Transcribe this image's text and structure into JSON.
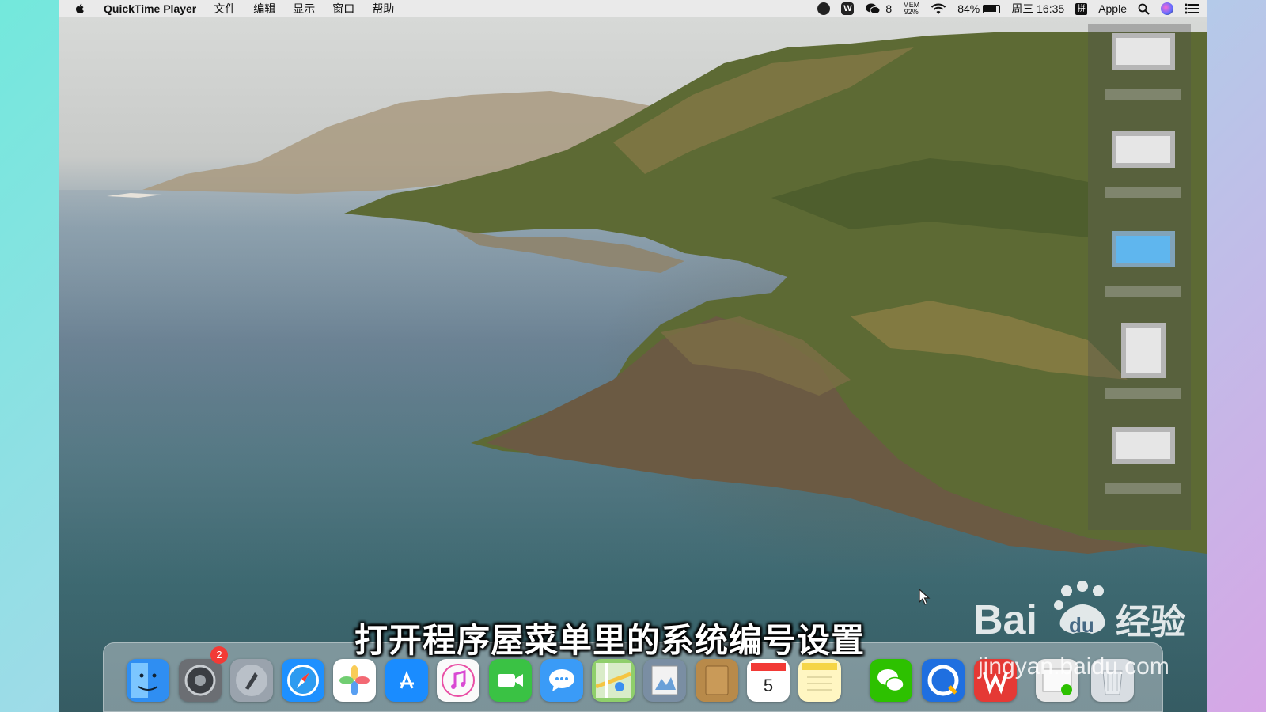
{
  "menubar": {
    "app_name": "QuickTime Player",
    "menus": [
      "文件",
      "编辑",
      "显示",
      "窗口",
      "帮助"
    ],
    "wechat_count": "8",
    "mem_label": "MEM",
    "mem_value": "92%",
    "battery_percent": "84%",
    "battery_level": 0.84,
    "datetime": "周三 16:35",
    "input_method": "拼",
    "user": "Apple"
  },
  "desktop_items": [
    "file",
    "file",
    "folder",
    "document",
    "file"
  ],
  "dock": {
    "icons": [
      {
        "name": "finder-icon",
        "color": "#2f8ef2"
      },
      {
        "name": "system-preferences-icon",
        "color": "#6b6e73",
        "badge": "2"
      },
      {
        "name": "launchpad-icon",
        "color": "#9aa3ad"
      },
      {
        "name": "safari-icon",
        "color": "#1e90ff"
      },
      {
        "name": "photos-icon",
        "color": "#ffffff"
      },
      {
        "name": "app-store-icon",
        "color": "#1a8cff"
      },
      {
        "name": "itunes-icon",
        "color": "#fafafa"
      },
      {
        "name": "facetime-icon",
        "color": "#3ac244"
      },
      {
        "name": "messages-icon",
        "color": "#3a9bf7"
      },
      {
        "name": "maps-icon",
        "color": "#8fcf6b"
      },
      {
        "name": "preview-icon",
        "color": "#7a8ea3"
      },
      {
        "name": "notefile-icon",
        "color": "#b88a4a"
      },
      {
        "name": "calendar-icon",
        "color": "#ffffff",
        "text": "5"
      },
      {
        "name": "notes-icon",
        "color": "#fff6c2"
      },
      {
        "name": "wechat-icon",
        "color": "#2dc100"
      },
      {
        "name": "qq-browser-icon",
        "color": "#1f6fe0"
      },
      {
        "name": "wps-icon",
        "color": "#e53935"
      },
      {
        "name": "wechat-files-icon",
        "color": "#e8e8e8"
      },
      {
        "name": "trash-icon",
        "color": "#d8dde2"
      }
    ]
  },
  "subtitle": "打开程序屋菜单里的系统编号设置",
  "watermark": {
    "brand": "Bai经验",
    "url": "jingyan.baidu.com"
  }
}
